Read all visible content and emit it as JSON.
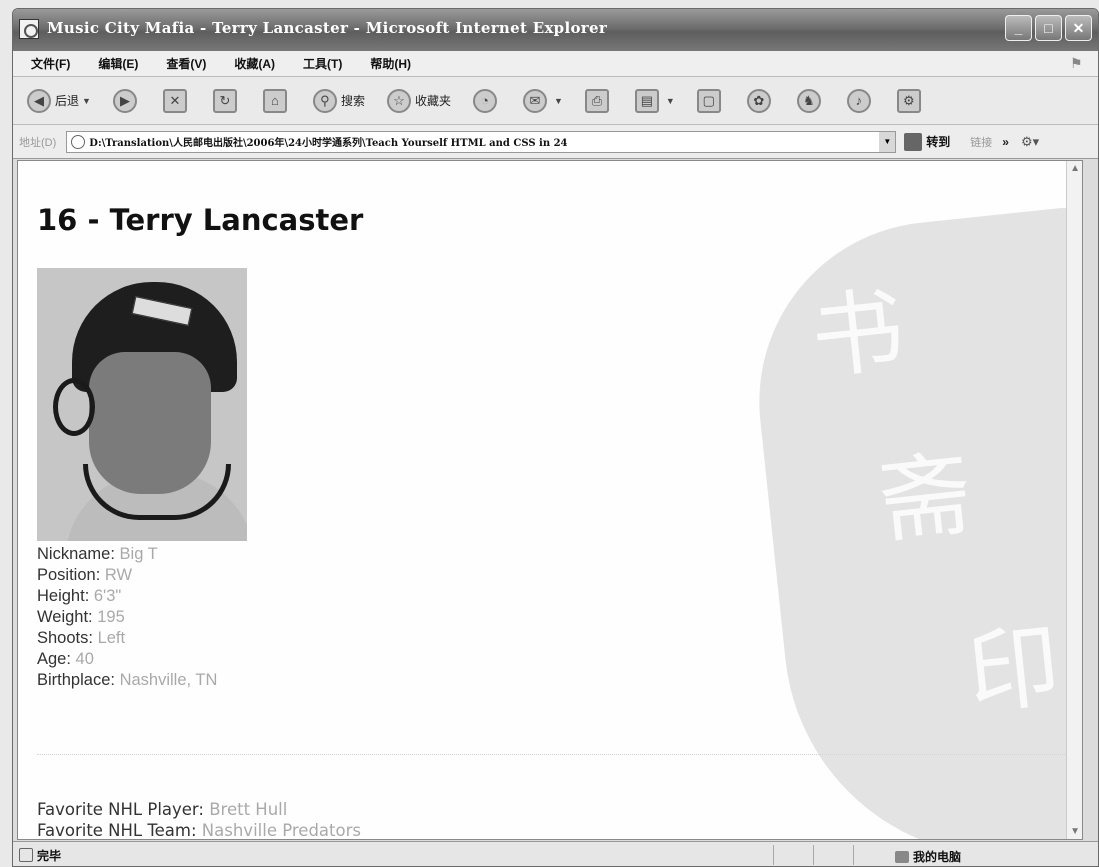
{
  "window": {
    "title": "Music City Mafia - Terry Lancaster - Microsoft Internet Explorer",
    "controls": [
      "_",
      "□",
      "✕"
    ]
  },
  "menubar": {
    "items": [
      "文件(F)",
      "编辑(E)",
      "查看(V)",
      "收藏(A)",
      "工具(T)",
      "帮助(H)"
    ]
  },
  "toolbar": {
    "back_label": "后退",
    "search_label": "搜索",
    "favorites_label": "收藏夹"
  },
  "addressbar": {
    "label": "地址(D)",
    "value": "D:\\Translation\\人民邮电出版社\\2006年\\24小时学通系列\\Teach Yourself HTML and CSS in 24",
    "go_label": "转到",
    "links_label": "链接",
    "more": "»"
  },
  "page": {
    "title": "16 - Terry Lancaster",
    "details": [
      {
        "label": "Nickname:",
        "value": "Big T"
      },
      {
        "label": "Position:",
        "value": "RW"
      },
      {
        "label": "Height:",
        "value": "6'3\""
      },
      {
        "label": "Weight:",
        "value": "195"
      },
      {
        "label": "Shoots:",
        "value": "Left"
      },
      {
        "label": "Age:",
        "value": "40"
      },
      {
        "label": "Birthplace:",
        "value": "Nashville, TN"
      }
    ],
    "favorites": [
      {
        "label": "Favorite NHL Player:",
        "value": "Brett Hull"
      },
      {
        "label": "Favorite NHL Team:",
        "value": "Nashville Predators"
      }
    ]
  },
  "statusbar": {
    "status": "完毕",
    "zone": "我的电脑"
  }
}
